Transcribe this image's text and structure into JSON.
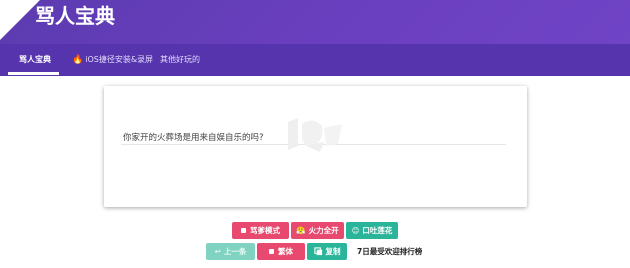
{
  "app": {
    "title": "骂人宝典"
  },
  "tabs": [
    {
      "label": "骂人宝典",
      "active": true
    },
    {
      "label": "iOS捷径安装&录屏",
      "icon": "fire-icon"
    },
    {
      "label": "其他好玩的"
    }
  ],
  "main": {
    "sentence": "你家开的火葬场是用来自娱自乐的吗?",
    "watermark_icon": "site-watermark-logo"
  },
  "buttons": {
    "mode": "骂爹模式",
    "fire": "火力全开",
    "lotus": "口吐莲花",
    "prev": "上一条",
    "traditional": "繁体",
    "copy": "复制",
    "rank": "7日最受欢迎排行榜"
  },
  "colors": {
    "header": "#5b3bb0",
    "pink": "#e8496f",
    "teal": "#2ab59a"
  }
}
